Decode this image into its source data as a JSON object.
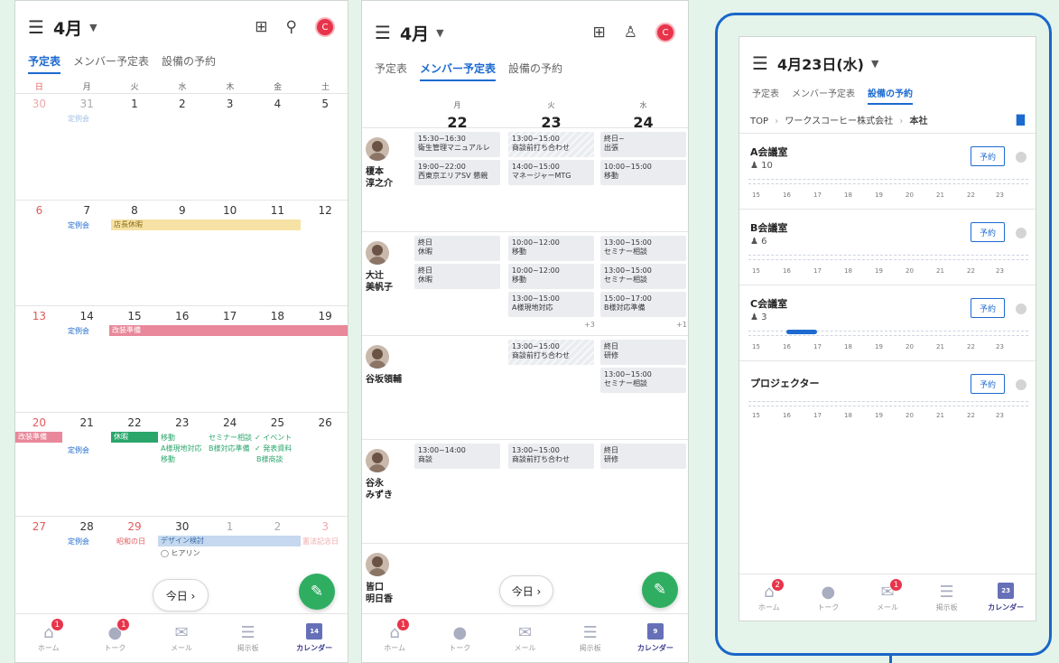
{
  "month_view": {
    "title": "4月",
    "avatar": "C",
    "tabs": [
      "予定表",
      "メンバー予定表",
      "設備の予約"
    ],
    "weekdays": [
      "日",
      "月",
      "火",
      "水",
      "木",
      "金",
      "土"
    ],
    "weeks": [
      {
        "days": [
          "30",
          "31",
          "1",
          "2",
          "3",
          "4",
          "5"
        ]
      },
      {
        "days": [
          "6",
          "7",
          "8",
          "9",
          "10",
          "11",
          "12"
        ]
      },
      {
        "days": [
          "13",
          "14",
          "15",
          "16",
          "17",
          "18",
          "19"
        ]
      },
      {
        "days": [
          "20",
          "21",
          "22",
          "23",
          "24",
          "25",
          "26"
        ]
      },
      {
        "days": [
          "27",
          "28",
          "29",
          "30",
          "1",
          "2",
          "3"
        ]
      }
    ],
    "events": {
      "w1_mon": "定例会",
      "w2_mon": "定例会",
      "w2_bar": "店長休暇",
      "w3_mon": "定例会",
      "w3_bar": "改装準備",
      "w4_bar_sun": "改装準備",
      "w4_mon": "定例会",
      "w4_tue_bar": "休暇",
      "w4_wed": [
        "移動",
        "A様現地対応",
        "移動"
      ],
      "w4_thu": [
        "セミナー相談",
        "B様対応準備"
      ],
      "w4_fri": [
        "✓ イベント",
        "✓ 発表資料",
        "B様商談"
      ],
      "w5_mon": "定例会",
      "w5_tue": "昭和の日",
      "w5_bar": "デザイン検討",
      "w5_wed2": "◯ ヒアリン",
      "w5_sat": "憲法記念日"
    },
    "today_button": "今日 ›",
    "nav": [
      {
        "label": "ホーム",
        "badge": "1"
      },
      {
        "label": "トーク",
        "badge": "1"
      },
      {
        "label": "メール"
      },
      {
        "label": "掲示板"
      },
      {
        "label": "カレンダー",
        "icon_day": "14"
      }
    ]
  },
  "member_view": {
    "title": "4月",
    "avatar": "C",
    "tabs": [
      "予定表",
      "メンバー予定表",
      "設備の予約"
    ],
    "columns": [
      {
        "dow": "月",
        "date": "22"
      },
      {
        "dow": "火",
        "date": "23"
      },
      {
        "dow": "水",
        "date": "24"
      }
    ],
    "members": [
      {
        "name": "榎本\n淳之介",
        "events": [
          [
            "15:30~16:30",
            "衛生管理マニュアルレ"
          ],
          [
            "13:00~15:00",
            "商談前打ち合わせ"
          ],
          [
            "終日~",
            "出張"
          ],
          [
            "19:00~22:00",
            "西東京エリアSV 懇親"
          ],
          [
            "14:00~15:00",
            "マネージャーMTG"
          ],
          [
            "10:00~15:00",
            "移動"
          ]
        ]
      },
      {
        "name": "大辻\n美帆子",
        "events": [
          [
            "終日",
            "休暇"
          ],
          [
            "10:00~12:00",
            "移動"
          ],
          [
            "13:00~15:00",
            "セミナー相談"
          ],
          [
            "終日",
            "休暇"
          ],
          [
            "10:00~12:00",
            "移動"
          ],
          [
            "13:00~15:00",
            "セミナー相談"
          ],
          [
            "13:00~15:00",
            "A様現地対応"
          ],
          [
            "15:00~17:00",
            "B様対応準備"
          ]
        ],
        "more": [
          "+3",
          "+1"
        ]
      },
      {
        "name": "谷坂領輔",
        "events": [
          [
            "13:00~15:00",
            "商談前打ち合わせ"
          ],
          [
            "終日",
            "研修"
          ],
          [
            "13:00~15:00",
            "セミナー相談"
          ]
        ]
      },
      {
        "name": "谷永\nみずき",
        "events": [
          [
            "13:00~14:00",
            "商談"
          ],
          [
            "13:00~15:00",
            "商談前打ち合わせ"
          ],
          [
            "終日",
            "研修"
          ]
        ]
      },
      {
        "name": "皆口\n明日香"
      }
    ],
    "today_button": "今日 ›",
    "nav": [
      {
        "label": "ホーム",
        "badge": "1"
      },
      {
        "label": "トーク"
      },
      {
        "label": "メール"
      },
      {
        "label": "掲示板"
      },
      {
        "label": "カレンダー",
        "icon_day": "9"
      }
    ]
  },
  "facility_view": {
    "title": "4月23日(水)",
    "tabs": [
      "予定表",
      "メンバー予定表",
      "設備の予約"
    ],
    "breadcrumb": {
      "top": "TOP",
      "sep": "›",
      "company": "ワークスコーヒー株式会社",
      "current": "本社"
    },
    "rooms": [
      {
        "name": "A会議室",
        "capacity": "10",
        "reserve": "予約"
      },
      {
        "name": "B会議室",
        "capacity": "6",
        "reserve": "予約"
      },
      {
        "name": "C会議室",
        "capacity": "3",
        "reserve": "予約",
        "booking_hours": [
          16,
          17
        ]
      },
      {
        "name": "プロジェクター",
        "capacity": "",
        "reserve": "予約"
      }
    ],
    "hours": [
      "15",
      "16",
      "17",
      "18",
      "19",
      "20",
      "21",
      "22",
      "23"
    ],
    "nav": [
      {
        "label": "ホーム",
        "badge": "2"
      },
      {
        "label": "トーク"
      },
      {
        "label": "メール",
        "badge": "1"
      },
      {
        "label": "掲示板"
      },
      {
        "label": "カレンダー",
        "icon_day": "23"
      }
    ]
  },
  "colors": {
    "accent": "#1c6ad0",
    "red": "#e8344a",
    "green": "#2fae62",
    "frame": "#1a66c9"
  }
}
